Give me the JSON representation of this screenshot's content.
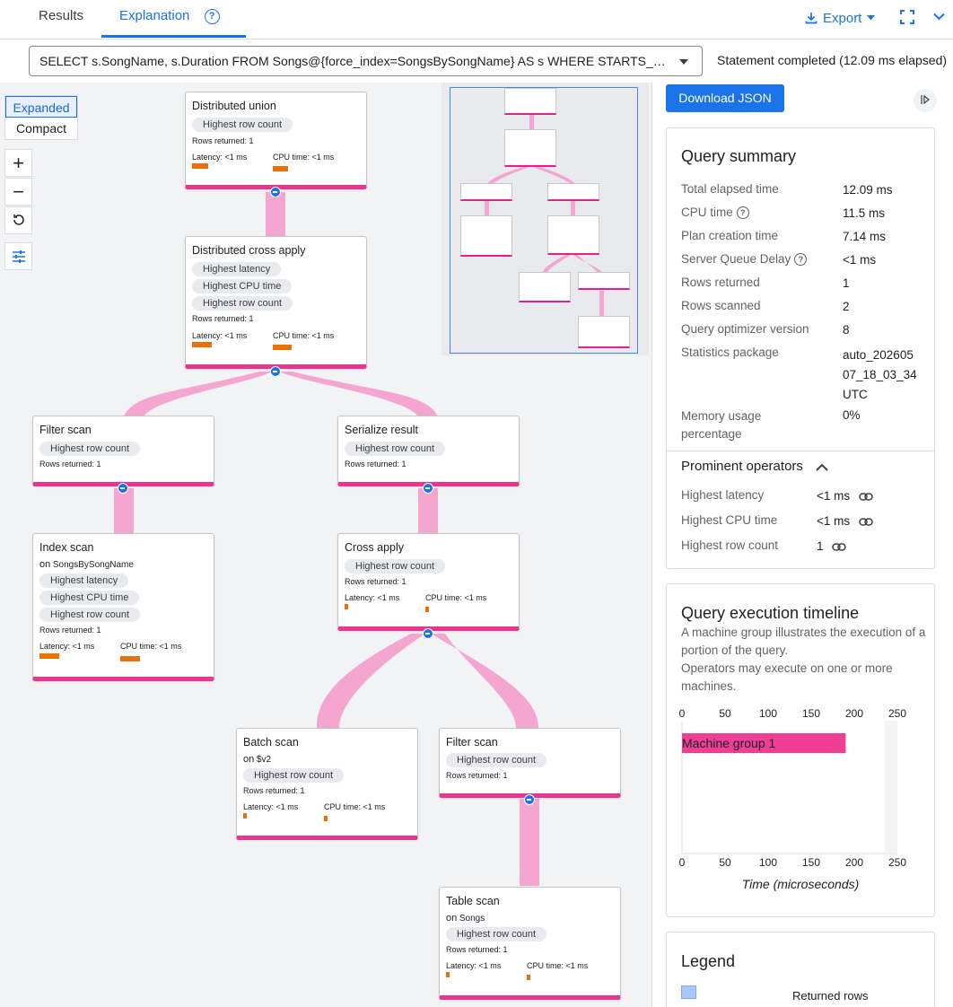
{
  "tabs": [
    {
      "label": "Results"
    },
    {
      "label": "Explanation"
    }
  ],
  "toolbar": {
    "export_label": "Export"
  },
  "query": {
    "text": "SELECT s.SongName, s.Duration FROM Songs@{force_index=SongsBySongName} AS s WHERE STARTS_WITH...",
    "status": "Statement completed (12.09 ms elapsed)"
  },
  "view": {
    "expanded_label": "Expanded",
    "compact_label": "Compact"
  },
  "plan": {
    "nodes": {
      "distributed_union": {
        "title": "Distributed union",
        "chips": [
          "Highest row count"
        ],
        "rows": "Rows returned: 1",
        "latency": "Latency: <1 ms",
        "cpu": "CPU time: <1 ms"
      },
      "distributed_cross_apply": {
        "title": "Distributed cross apply",
        "chips": [
          "Highest latency",
          "Highest CPU time",
          "Highest row count"
        ],
        "rows": "Rows returned: 1",
        "latency": "Latency: <1 ms",
        "cpu": "CPU time: <1 ms"
      },
      "filter_scan_left": {
        "title": "Filter scan",
        "chips": [
          "Highest row count"
        ],
        "rows": "Rows returned: 1"
      },
      "serialize_result": {
        "title": "Serialize result",
        "chips": [
          "Highest row count"
        ],
        "rows": "Rows returned: 1"
      },
      "index_scan": {
        "title": "Index scan",
        "on_prefix": "on",
        "on_target": "SongsBySongName",
        "chips": [
          "Highest latency",
          "Highest CPU time",
          "Highest row count"
        ],
        "rows": "Rows returned: 1",
        "latency": "Latency: <1 ms",
        "cpu": "CPU time: <1 ms"
      },
      "cross_apply": {
        "title": "Cross apply",
        "chips": [
          "Highest row count"
        ],
        "rows": "Rows returned: 1",
        "latency": "Latency: <1 ms",
        "cpu": "CPU time: <1 ms"
      },
      "batch_scan": {
        "title": "Batch scan",
        "on_prefix": "on",
        "on_target": "$v2",
        "chips": [
          "Highest row count"
        ],
        "rows": "Rows returned: 1",
        "latency": "Latency: <1 ms",
        "cpu": "CPU time: <1 ms"
      },
      "filter_scan_right": {
        "title": "Filter scan",
        "chips": [
          "Highest row count"
        ],
        "rows": "Rows returned: 1"
      },
      "table_scan": {
        "title": "Table scan",
        "on_prefix": "on",
        "on_target": "Songs",
        "chips": [
          "Highest row count"
        ],
        "rows": "Rows returned: 1",
        "latency": "Latency: <1 ms",
        "cpu": "CPU time: <1 ms"
      }
    }
  },
  "panel": {
    "download_label": "Download JSON",
    "summary": {
      "title": "Query summary",
      "rows": [
        {
          "label": "Total elapsed time",
          "value": "12.09 ms"
        },
        {
          "label": "CPU time",
          "value": "11.5 ms"
        },
        {
          "label": "Plan creation time",
          "value": "7.14 ms"
        },
        {
          "label": "Server Queue Delay",
          "value": "<1 ms"
        },
        {
          "label": "Rows returned",
          "value": "1"
        },
        {
          "label": "Rows scanned",
          "value": "2"
        },
        {
          "label": "Query optimizer version",
          "value": "8"
        },
        {
          "label": "Statistics package",
          "value": "auto_20260507_18_03_34UTC"
        },
        {
          "label": "Memory usage percentage",
          "value": "0%"
        }
      ],
      "prominent_title": "Prominent operators",
      "prominent": [
        {
          "label": "Highest latency",
          "value": "<1 ms"
        },
        {
          "label": "Highest CPU time",
          "value": "<1 ms"
        },
        {
          "label": "Highest row count",
          "value": "1"
        }
      ]
    },
    "timeline": {
      "title": "Query execution timeline",
      "description_1": "A machine group illustrates the execution of a portion of the query.",
      "description_2": "Operators may execute on one or more machines.",
      "xlabel": "Time (microseconds)"
    },
    "legend": {
      "title": "Legend",
      "items": [
        {
          "label": "Returned rows",
          "color": "#a8c7fa"
        }
      ]
    }
  },
  "colors": {
    "accent": "#1a73e8",
    "node_border": "#e8358e",
    "edge": "#f4a6d0",
    "metric_bar": "#e8710a",
    "machine_bar": "#ee3f95"
  },
  "chart_data": {
    "type": "bar",
    "orientation": "horizontal",
    "categories": [
      "Machine group 1"
    ],
    "values": [
      190
    ],
    "xlim": [
      0,
      250
    ],
    "xticks": [
      0,
      50,
      100,
      150,
      200,
      250
    ],
    "xlabel": "Time (microseconds)"
  }
}
